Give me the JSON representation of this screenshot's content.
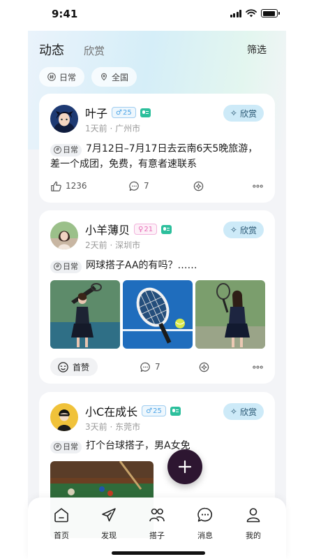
{
  "status_bar": {
    "time": "9:41",
    "battery_level": 0.9
  },
  "header": {
    "tabs": [
      {
        "label": "动态",
        "active": true
      },
      {
        "label": "欣赏",
        "active": false
      }
    ],
    "filter_label": "筛选",
    "chips": [
      {
        "label": "日常",
        "icon": "hash-icon"
      },
      {
        "label": "全国",
        "icon": "location-icon"
      }
    ]
  },
  "posts": [
    {
      "name": "叶子",
      "gender": "male",
      "age": "25",
      "meta": "1天前 · 广州市",
      "appreciate_label": "欣赏",
      "tag": "日常",
      "text": "7月12日–7月17日去云南6天5晚旅游，差一个成团，免费，有意者速联系",
      "likes": "1236",
      "comments": "7"
    },
    {
      "name": "小羊薄贝",
      "gender": "female",
      "age": "21",
      "meta": "2天前 · 深圳市",
      "appreciate_label": "欣赏",
      "tag": "日常",
      "text": "网球搭子AA的有吗？……",
      "first_like_label": "首赞",
      "comments": "7",
      "photos": [
        "tennis-player-photo",
        "tennis-racket-photo",
        "tennis-player-photo"
      ]
    },
    {
      "name": "小C在成长",
      "gender": "male",
      "age": "25",
      "meta": "3天前 · 东莞市",
      "appreciate_label": "欣赏",
      "tag": "日常",
      "text": "打个台球搭子，男A女免",
      "photos": [
        "billiards-photo"
      ]
    }
  ],
  "bottom_nav": [
    {
      "label": "首页",
      "icon": "home-icon"
    },
    {
      "label": "发现",
      "icon": "discover-icon"
    },
    {
      "label": "搭子",
      "icon": "partners-icon"
    },
    {
      "label": "消息",
      "icon": "message-icon"
    },
    {
      "label": "我的",
      "icon": "profile-icon"
    }
  ],
  "colors": {
    "accent": "#2d1631",
    "appreciate_bg": "#cdeaf8",
    "male_badge": "#4aa3e6",
    "female_badge": "#e86bb7",
    "verified": "#2cbf9c"
  }
}
